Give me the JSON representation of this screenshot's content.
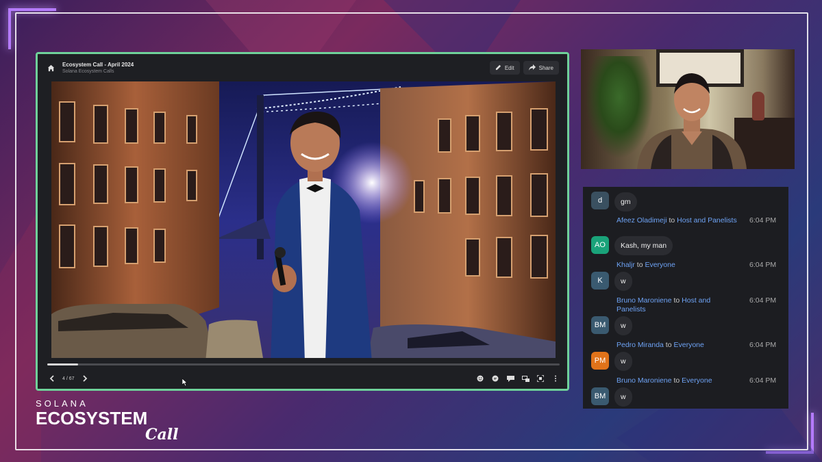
{
  "presentation": {
    "title": "Ecosystem Call - April 2024",
    "subtitle": "Solana Ecosystem Calls",
    "edit_label": "Edit",
    "share_label": "Share",
    "page_indicator": "4 / 67",
    "progress_fraction": 0.06
  },
  "chat": {
    "messages": [
      {
        "avatar": "d",
        "avatar_color": "#3a5060",
        "sender": "",
        "recipient": "",
        "time": "",
        "text": "gm"
      },
      {
        "avatar": "AO",
        "avatar_color": "#1aa37a",
        "sender": "Afeez Oladimeji",
        "recipient": "Host and Panelists",
        "time": "6:04 PM",
        "text": "Kash, my man"
      },
      {
        "avatar": "K",
        "avatar_color": "#3a5a70",
        "sender": "Khaljr",
        "recipient": "Everyone",
        "time": "6:04 PM",
        "text": "w"
      },
      {
        "avatar": "BM",
        "avatar_color": "#3a5a70",
        "sender": "Bruno Maroniene",
        "recipient": "Host and Panelists",
        "time": "6:04 PM",
        "text": "w"
      },
      {
        "avatar": "PM",
        "avatar_color": "#e0731a",
        "sender": "Pedro Miranda",
        "recipient": "Everyone",
        "time": "6:04 PM",
        "text": "w"
      },
      {
        "avatar": "BM",
        "avatar_color": "#3a5a70",
        "sender": "Bruno Maroniene",
        "recipient": "Everyone",
        "time": "6:04 PM",
        "text": "w"
      }
    ],
    "to_word": "to"
  },
  "logo": {
    "top": "SOLANA",
    "main": "ECOSYSTEM",
    "script": "Call"
  },
  "icons": [
    "home-icon",
    "edit-icon",
    "share-icon",
    "prev-icon",
    "next-icon",
    "emoji-icon",
    "chat-icon",
    "captions-icon",
    "pip-icon",
    "fullscreen-icon",
    "more-icon",
    "cursor-icon"
  ]
}
